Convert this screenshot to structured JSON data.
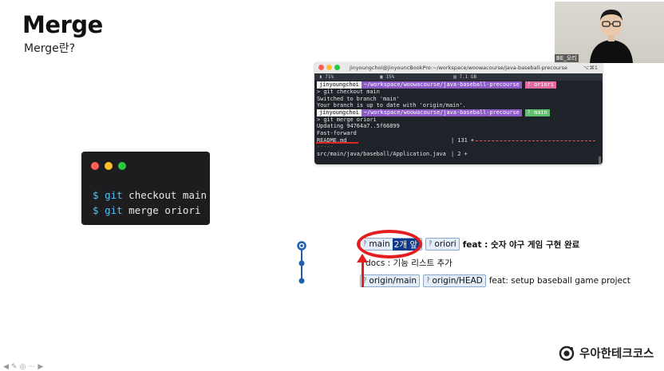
{
  "slide": {
    "title": "Merge",
    "subtitle": "Merge란?"
  },
  "code_card": {
    "dot_colors": [
      "#ff5f56",
      "#ffbd2e",
      "#27c93f"
    ],
    "lines": [
      {
        "prompt": "$",
        "cmd": "git",
        "args": " checkout main"
      },
      {
        "prompt": "$",
        "cmd": "git",
        "args": " merge oriori"
      }
    ]
  },
  "terminal": {
    "title": "jinyoungchoi@jinyouncBookPro:~/workspace/woowacourse/java-baseball-precourse",
    "shortcut": "⌥⌘1",
    "status": {
      "battery": "71%",
      "cpu": "15%",
      "memory": "7.1 GB"
    },
    "prompt1": {
      "user": "jinyoungchoi",
      "path": "~/workspace/woowacourse/java-baseball-precourse",
      "branch": "oriori"
    },
    "cmd1": "git checkout main",
    "out1": "Switched to branch 'main'",
    "out2": "Your branch is up to date with 'origin/main'.",
    "prompt2": {
      "user": "jinyoungchoi",
      "path": "~/workspace/woowacourse/java-baseball-precourse",
      "branch": "main"
    },
    "cmd2": "git merge oriori",
    "out3": "Updating 94764a7..5f66899",
    "out4": "Fast-forward",
    "out5_file": " README.md",
    "out5_stat": "| 131 +",
    "out6": " -----",
    "out7_file": " src/main/java/baseball/Application.java",
    "out7_stat": "|   2 +",
    "branch_glyph": "ᚹ",
    "caret": ">"
  },
  "webcam": {
    "name_tag": "BE_오리"
  },
  "git_graph": {
    "commits": [
      {
        "refs": [
          {
            "label": "main",
            "badge": "2개 앞",
            "icon": "branch-icon"
          },
          {
            "label": "oriori",
            "icon": "branch-icon"
          }
        ],
        "message": "feat : 숫자 야구 게임 구현 완료"
      },
      {
        "refs": [],
        "message": "docs : 기능 리스트 추가"
      },
      {
        "refs": [
          {
            "label": "origin/main",
            "icon": "branch-icon"
          },
          {
            "label": "origin/HEAD",
            "icon": "branch-icon"
          }
        ],
        "message": "feat: setup baseball game project"
      }
    ],
    "node_color": "#1f5fae"
  },
  "annotation": {
    "color": "#e41e1e"
  },
  "branding": {
    "logo_text": "우아한테크코스"
  }
}
